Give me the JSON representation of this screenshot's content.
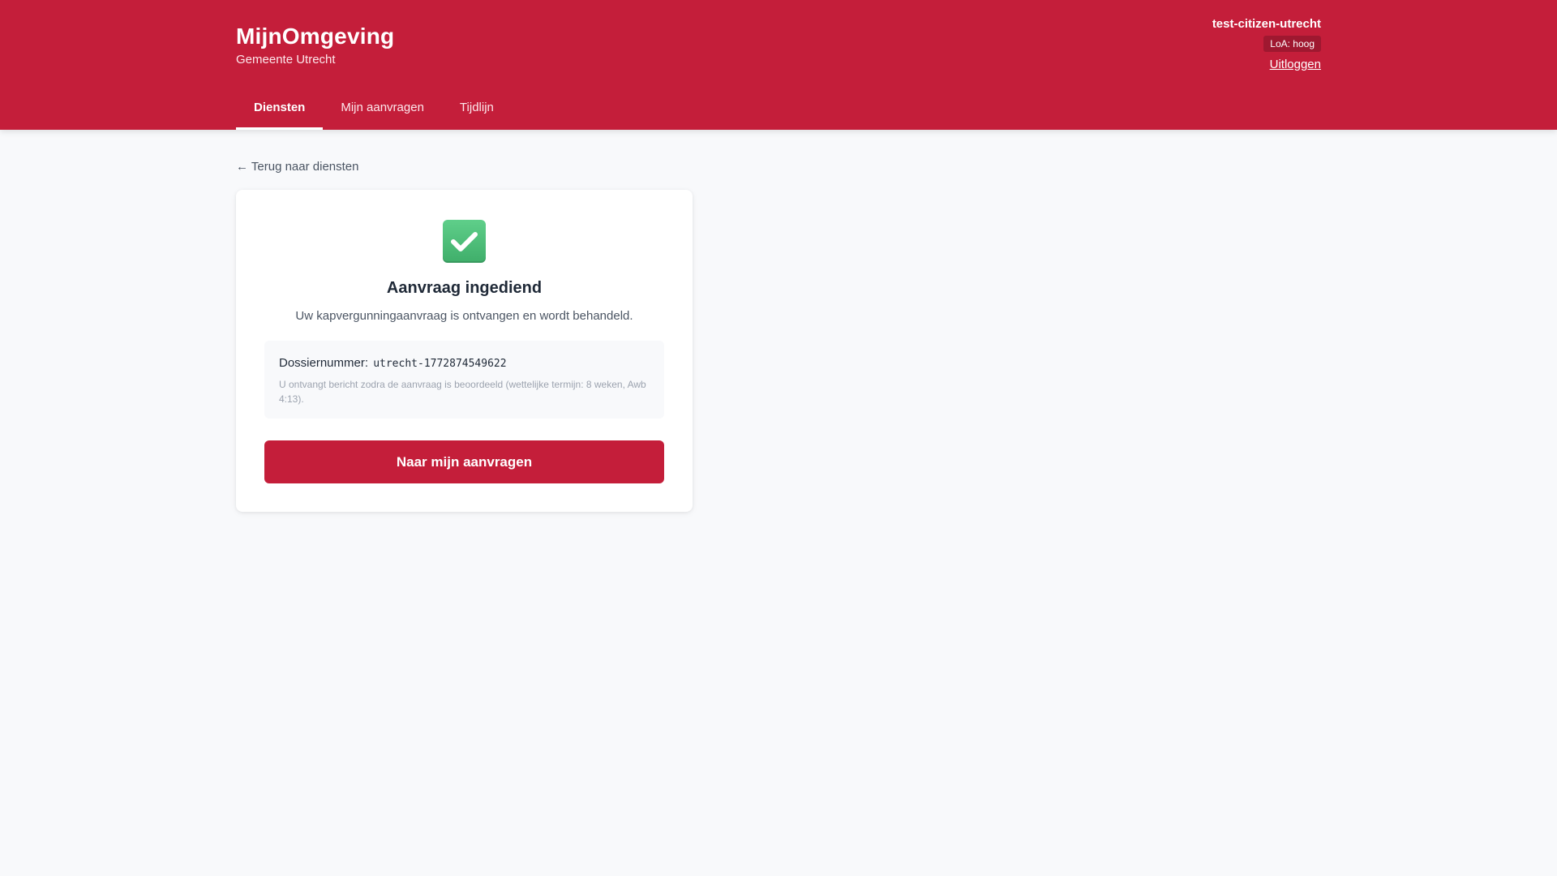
{
  "header": {
    "brand_title": "MijnOmgeving",
    "brand_subtitle": "Gemeente Utrecht",
    "user_name": "test-citizen-utrecht",
    "loa_badge": "LoA: hoog",
    "logout_label": "Uitloggen",
    "accent_color": "#c41e3a"
  },
  "nav": {
    "tabs": [
      {
        "label": "Diensten",
        "active": true
      },
      {
        "label": "Mijn aanvragen",
        "active": false
      },
      {
        "label": "Tijdlijn",
        "active": false
      }
    ]
  },
  "main": {
    "back_link": "← Terug naar diensten",
    "card": {
      "icon": "check-mark-icon",
      "title": "Aanvraag ingediend",
      "subtitle": "Uw kapvergunningaanvraag is ontvangen en wordt behandeld.",
      "dossier_label": "Dossiernummer:",
      "dossier_value": "utrecht-1772874549622",
      "note": "U ontvangt bericht zodra de aanvraag is beoordeeld (wettelijke termijn: 8 weken, Awb 4:13).",
      "button_label": "Naar mijn aanvragen"
    }
  }
}
